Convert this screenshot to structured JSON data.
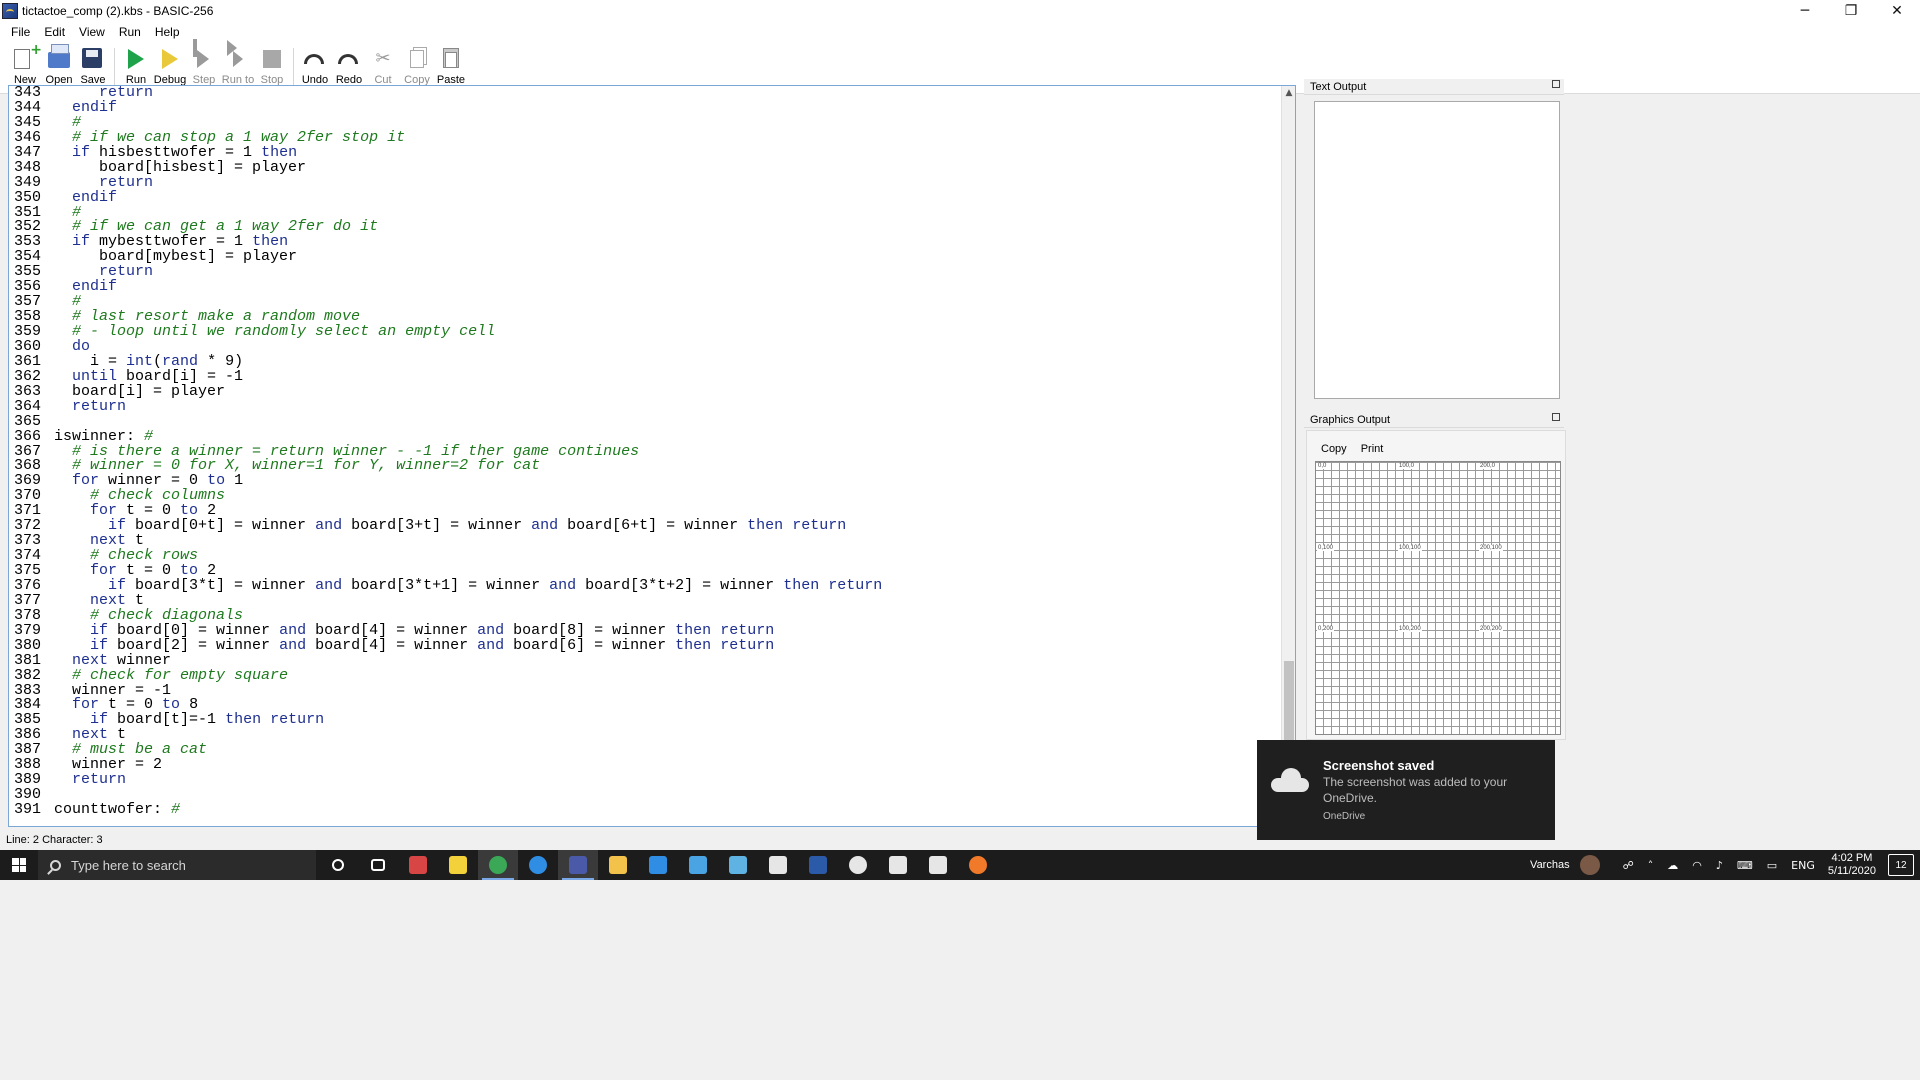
{
  "window": {
    "title": "tictactoe_comp (2).kbs - BASIC-256",
    "minimize": "─",
    "maximize": "❐",
    "close": "✕"
  },
  "menu": [
    "File",
    "Edit",
    "View",
    "Run",
    "Help"
  ],
  "toolbar": [
    {
      "label": "New",
      "icon": "new-file-icon",
      "enabled": true
    },
    {
      "label": "Open",
      "icon": "open-folder-icon",
      "enabled": true
    },
    {
      "label": "Save",
      "icon": "save-disk-icon",
      "enabled": true
    },
    {
      "label": "Run",
      "icon": "play-icon",
      "enabled": true
    },
    {
      "label": "Debug",
      "icon": "debug-icon",
      "enabled": true
    },
    {
      "label": "Step",
      "icon": "step-icon",
      "enabled": false
    },
    {
      "label": "Run to",
      "icon": "run-to-icon",
      "enabled": false
    },
    {
      "label": "Stop",
      "icon": "stop-icon",
      "enabled": false
    },
    {
      "label": "Undo",
      "icon": "undo-icon",
      "enabled": true
    },
    {
      "label": "Redo",
      "icon": "redo-icon",
      "enabled": true
    },
    {
      "label": "Cut",
      "icon": "scissors-icon",
      "enabled": false
    },
    {
      "label": "Copy",
      "icon": "copy-icon",
      "enabled": false
    },
    {
      "label": "Paste",
      "icon": "paste-icon",
      "enabled": true
    }
  ],
  "code": [
    {
      "n": "343",
      "t": "      return"
    },
    {
      "n": "344",
      "t": "   endif"
    },
    {
      "n": "345",
      "t": "   #"
    },
    {
      "n": "346",
      "t": "   # if we can stop a 1 way 2fer stop it"
    },
    {
      "n": "347",
      "t": "   if hisbesttwofer = 1 then"
    },
    {
      "n": "348",
      "t": "      board[hisbest] = player"
    },
    {
      "n": "349",
      "t": "      return"
    },
    {
      "n": "350",
      "t": "   endif"
    },
    {
      "n": "351",
      "t": "   #"
    },
    {
      "n": "352",
      "t": "   # if we can get a 1 way 2fer do it"
    },
    {
      "n": "353",
      "t": "   if mybesttwofer = 1 then"
    },
    {
      "n": "354",
      "t": "      board[mybest] = player"
    },
    {
      "n": "355",
      "t": "      return"
    },
    {
      "n": "356",
      "t": "   endif"
    },
    {
      "n": "357",
      "t": "   #"
    },
    {
      "n": "358",
      "t": "   # last resort make a random move"
    },
    {
      "n": "359",
      "t": "   # - loop until we randomly select an empty cell"
    },
    {
      "n": "360",
      "t": "   do"
    },
    {
      "n": "361",
      "t": "     i = int(rand * 9)"
    },
    {
      "n": "362",
      "t": "   until board[i] = -1"
    },
    {
      "n": "363",
      "t": "   board[i] = player"
    },
    {
      "n": "364",
      "t": "   return"
    },
    {
      "n": "365",
      "t": ""
    },
    {
      "n": "366",
      "t": " iswinner: #"
    },
    {
      "n": "367",
      "t": "   # is there a winner = return winner - -1 if ther game continues"
    },
    {
      "n": "368",
      "t": "   # winner = 0 for X, winner=1 for Y, winner=2 for cat"
    },
    {
      "n": "369",
      "t": "   for winner = 0 to 1"
    },
    {
      "n": "370",
      "t": "     # check columns"
    },
    {
      "n": "371",
      "t": "     for t = 0 to 2"
    },
    {
      "n": "372",
      "t": "       if board[0+t] = winner and board[3+t] = winner and board[6+t] = winner then return"
    },
    {
      "n": "373",
      "t": "     next t"
    },
    {
      "n": "374",
      "t": "     # check rows"
    },
    {
      "n": "375",
      "t": "     for t = 0 to 2"
    },
    {
      "n": "376",
      "t": "       if board[3*t] = winner and board[3*t+1] = winner and board[3*t+2] = winner then return"
    },
    {
      "n": "377",
      "t": "     next t"
    },
    {
      "n": "378",
      "t": "     # check diagonals"
    },
    {
      "n": "379",
      "t": "     if board[0] = winner and board[4] = winner and board[8] = winner then return"
    },
    {
      "n": "380",
      "t": "     if board[2] = winner and board[4] = winner and board[6] = winner then return"
    },
    {
      "n": "381",
      "t": "   next winner"
    },
    {
      "n": "382",
      "t": "   # check for empty square"
    },
    {
      "n": "383",
      "t": "   winner = -1"
    },
    {
      "n": "384",
      "t": "   for t = 0 to 8"
    },
    {
      "n": "385",
      "t": "     if board[t]=-1 then return"
    },
    {
      "n": "386",
      "t": "   next t"
    },
    {
      "n": "387",
      "t": "   # must be a cat"
    },
    {
      "n": "388",
      "t": "   winner = 2"
    },
    {
      "n": "389",
      "t": "   return"
    },
    {
      "n": "390",
      "t": ""
    },
    {
      "n": "391",
      "t": " counttwofer: #"
    }
  ],
  "status": "Line: 2 Character: 3",
  "panels": {
    "text_output": "Text Output",
    "graphics_output": "Graphics Output",
    "gfx_copy": "Copy",
    "gfx_print": "Print",
    "grid_labels": [
      "0,0",
      "100,0",
      "200,0",
      "0,100",
      "100,100",
      "200,100",
      "0,200",
      "100,200",
      "200,200"
    ]
  },
  "toast": {
    "title": "Screenshot saved",
    "body": "The screenshot was added to your OneDrive.",
    "source": "OneDrive"
  },
  "taskbar": {
    "search_placeholder": "Type here to search",
    "user": "Varchas",
    "lang": "ENG",
    "time": "4:02 PM",
    "date": "5/11/2020",
    "notifications": "12",
    "apps": [
      {
        "name": "task-view-icon",
        "color": "#ffffff"
      },
      {
        "name": "news-app-icon",
        "color": "#d84545"
      },
      {
        "name": "sticky-notes-icon",
        "color": "#f2d13a"
      },
      {
        "name": "chrome-icon",
        "color": "#3aa857"
      },
      {
        "name": "edge-icon",
        "color": "#2f8ee3"
      },
      {
        "name": "basic256-icon",
        "color": "#4a5aa8"
      },
      {
        "name": "file-explorer-icon",
        "color": "#f2c24a"
      },
      {
        "name": "mail-icon",
        "color": "#2f8ee3"
      },
      {
        "name": "pen-app-icon",
        "color": "#4aa3e3"
      },
      {
        "name": "screen-app-icon",
        "color": "#5fb3e3"
      },
      {
        "name": "calculator-icon",
        "color": "#e6e6e6"
      },
      {
        "name": "word-icon",
        "color": "#2a5aa8"
      },
      {
        "name": "speedometer-icon",
        "color": "#e6e6e6"
      },
      {
        "name": "photos-icon",
        "color": "#e6e6e6"
      },
      {
        "name": "settings-gear-icon",
        "color": "#e6e6e6"
      },
      {
        "name": "firefox-icon",
        "color": "#f07a2a"
      }
    ]
  }
}
